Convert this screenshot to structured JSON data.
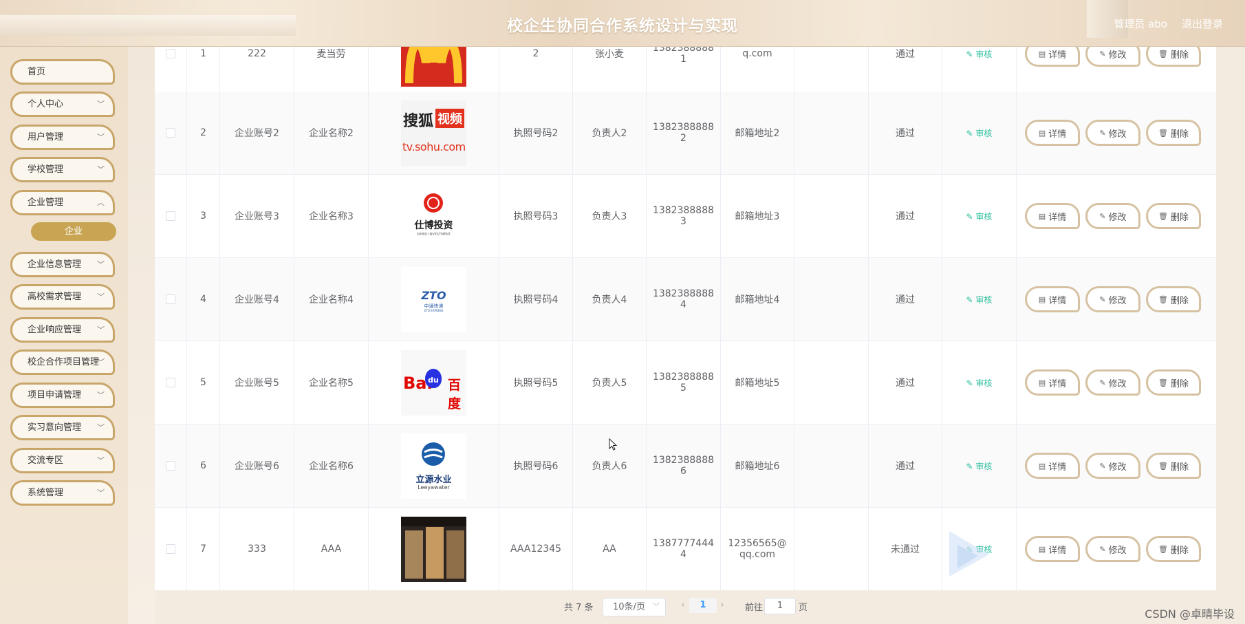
{
  "header": {
    "title": "校企生协同合作系统设计与实现",
    "user": "管理员 abo",
    "logout": "退出登录"
  },
  "sidebar": {
    "items": [
      {
        "label": "首页",
        "has_sub": false
      },
      {
        "label": "个人中心",
        "has_sub": true
      },
      {
        "label": "用户管理",
        "has_sub": true
      },
      {
        "label": "学校管理",
        "has_sub": true
      },
      {
        "label": "企业管理",
        "has_sub": true
      },
      {
        "label": "企业信息管理",
        "has_sub": true
      },
      {
        "label": "高校需求管理",
        "has_sub": true
      },
      {
        "label": "企业响应管理",
        "has_sub": true
      },
      {
        "label": "校企合作项目管理",
        "has_sub": true
      },
      {
        "label": "项目申请管理",
        "has_sub": true
      },
      {
        "label": "实习意向管理",
        "has_sub": true
      },
      {
        "label": "交流专区",
        "has_sub": true
      },
      {
        "label": "系统管理",
        "has_sub": true
      }
    ],
    "active_sub": "企业"
  },
  "table": {
    "rows": [
      {
        "index": "1",
        "account": "222",
        "name": "麦当劳",
        "logo": "mcdonalds",
        "license": "2",
        "person": "张小麦",
        "phone": "13823888881",
        "email": "q.com",
        "status": "通过"
      },
      {
        "index": "2",
        "account": "企业账号2",
        "name": "企业名称2",
        "logo": "sohu",
        "license": "执照号码2",
        "person": "负责人2",
        "phone": "13823888882",
        "email": "邮箱地址2",
        "status": "通过"
      },
      {
        "index": "3",
        "account": "企业账号3",
        "name": "企业名称3",
        "logo": "shibo",
        "license": "执照号码3",
        "person": "负责人3",
        "phone": "13823888883",
        "email": "邮箱地址3",
        "status": "通过"
      },
      {
        "index": "4",
        "account": "企业账号4",
        "name": "企业名称4",
        "logo": "zto",
        "license": "执照号码4",
        "person": "负责人4",
        "phone": "13823888884",
        "email": "邮箱地址4",
        "status": "通过"
      },
      {
        "index": "5",
        "account": "企业账号5",
        "name": "企业名称5",
        "logo": "baidu",
        "license": "执照号码5",
        "person": "负责人5",
        "phone": "13823888885",
        "email": "邮箱地址5",
        "status": "通过"
      },
      {
        "index": "6",
        "account": "企业账号6",
        "name": "企业名称6",
        "logo": "liyuan",
        "license": "执照号码6",
        "person": "负责人6",
        "phone": "13823888886",
        "email": "邮箱地址6",
        "status": "通过"
      },
      {
        "index": "7",
        "account": "333",
        "name": "AAA",
        "logo": "storefront",
        "license": "AAA12345",
        "person": "AA",
        "phone": "13877774444",
        "email": "12356565@qq.com",
        "status": "未通过"
      }
    ],
    "audit_label": "审核",
    "detail_label": "详情",
    "edit_label": "修改",
    "delete_label": "删除"
  },
  "logos": {
    "sohu_cn": "搜狐",
    "sohu_video": "视频",
    "sohu_url": "tv.sohu.com",
    "shibo": "仕博投资",
    "shibo_en": "SHIBO INVESTMENT",
    "zto": "ZTO",
    "zto_cn": "中通快递",
    "zto_en": "ZTO EXPRESS",
    "baidu_bai": "Bai",
    "baidu_du": "du",
    "baidu_cn": "百度",
    "liyuan_cn": "立源水业",
    "liyuan_en": "Leeyawater"
  },
  "pagination": {
    "total": "共 7 条",
    "page_size": "10条/页",
    "current": "1",
    "goto_label": "前往",
    "goto_value": "1",
    "page_label": "页"
  },
  "watermark": "CSDN @卓晴毕设",
  "colors": {
    "accent_gold": "#c8a453",
    "button_border": "#d6c2a2",
    "audit_green": "#2bbf9e"
  }
}
